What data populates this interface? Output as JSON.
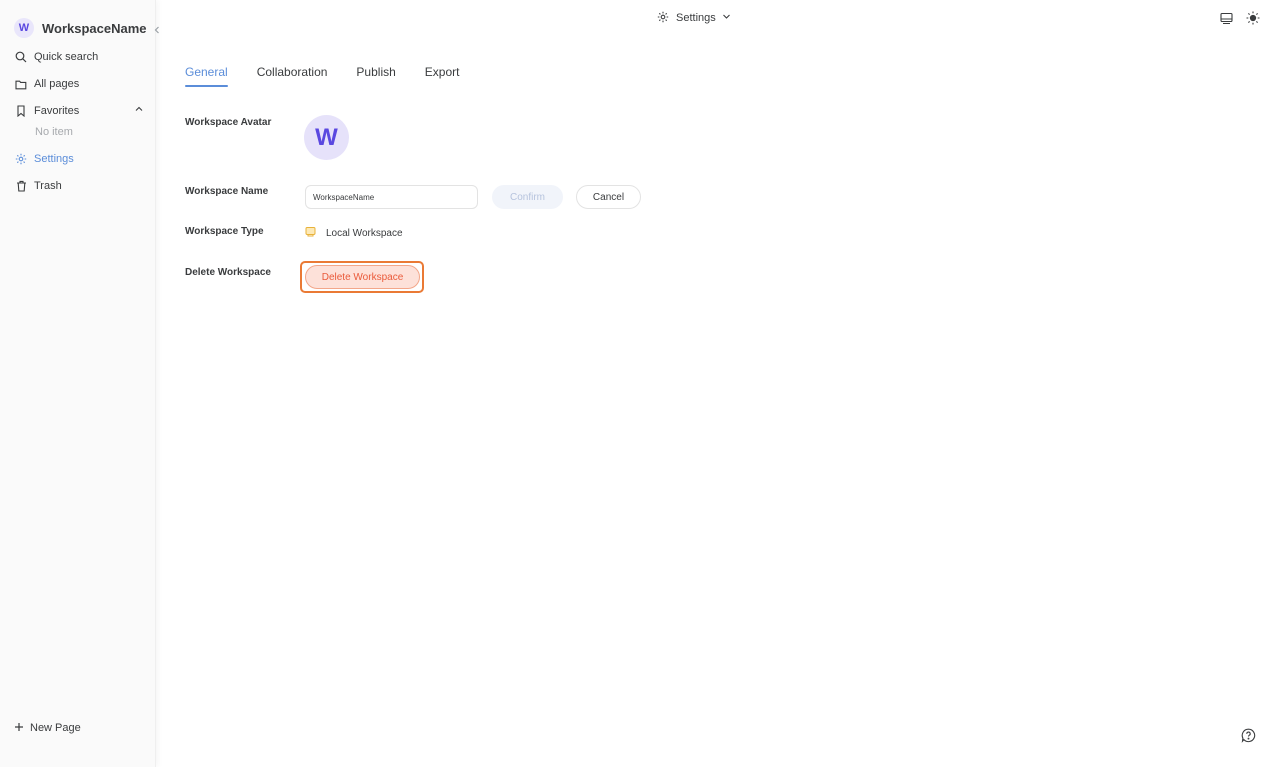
{
  "sidebar": {
    "workspace_initial": "W",
    "workspace_name": "WorkspaceName",
    "items": {
      "quick_search": "Quick search",
      "all_pages": "All pages",
      "favorites": "Favorites",
      "favorites_empty": "No item",
      "settings": "Settings",
      "trash": "Trash"
    },
    "new_page": "New Page"
  },
  "topbar": {
    "title": "Settings"
  },
  "tabs": [
    "General",
    "Collaboration",
    "Publish",
    "Export"
  ],
  "active_tab": "General",
  "general": {
    "avatar_label": "Workspace Avatar",
    "avatar_initial": "W",
    "name_label": "Workspace Name",
    "name_value": "WorkspaceName",
    "confirm_label": "Confirm",
    "cancel_label": "Cancel",
    "type_label": "Workspace Type",
    "type_value": "Local Workspace",
    "delete_label": "Delete Workspace",
    "delete_button": "Delete Workspace"
  },
  "colors": {
    "accent": "#5b8dd9",
    "avatar_bg": "#e6e2fa",
    "avatar_fg": "#5a48e0",
    "danger": "#ea5a3a",
    "focus_ring": "#ea7a35"
  },
  "icons": {
    "search": "search-icon",
    "folder": "folder-icon",
    "bookmark": "bookmark-icon",
    "gear": "gear-icon",
    "trash": "trash-icon",
    "plus": "plus-icon",
    "layout": "layout-icon",
    "theme": "sun-icon",
    "help": "help-icon"
  }
}
